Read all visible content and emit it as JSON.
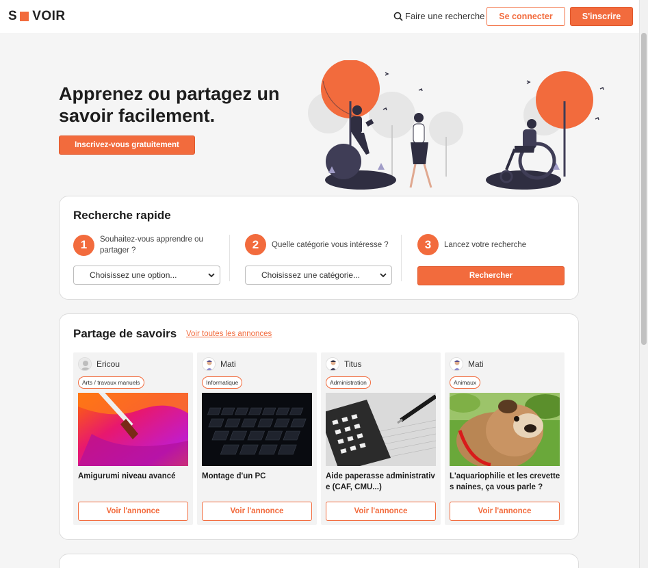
{
  "header": {
    "logo_left": "S",
    "logo_right": "VOIR",
    "search_label": "Faire une recherche",
    "login_label": "Se connecter",
    "signup_label": "S'inscrire"
  },
  "hero": {
    "title": "Apprenez ou partagez un savoir facilement.",
    "cta_label": "Inscrivez-vous gratuitement"
  },
  "quick_search": {
    "title": "Recherche rapide",
    "steps": [
      {
        "num": "1",
        "text": "Souhaitez-vous apprendre ou partager ?"
      },
      {
        "num": "2",
        "text": "Quelle catégorie vous intéresse ?"
      },
      {
        "num": "3",
        "text": "Lancez votre recherche"
      }
    ],
    "option_select": "Choisissez une option...",
    "category_select": "Choisissez une catégorie...",
    "search_button": "Rechercher"
  },
  "sharing": {
    "title": "Partage de savoirs",
    "see_all": "Voir toutes les annonces",
    "ads": [
      {
        "author": "Ericou",
        "tag": "Arts / travaux manuels",
        "title": "Amigurumi niveau avancé",
        "button": "Voir l'annonce"
      },
      {
        "author": "Mati",
        "tag": "Informatique",
        "title": "Montage d'un PC",
        "button": "Voir l'annonce"
      },
      {
        "author": "Titus",
        "tag": "Administration",
        "title": "Aide paperasse administrative (CAF, CMU...)",
        "button": "Voir l'annonce"
      },
      {
        "author": "Mati",
        "tag": "Animaux",
        "title": "L'aquariophilie et les crevettes naines, ça vous parle ?",
        "button": "Voir l'annonce"
      }
    ]
  },
  "colors": {
    "accent": "#f26b3d",
    "background": "#f5f5f5"
  }
}
